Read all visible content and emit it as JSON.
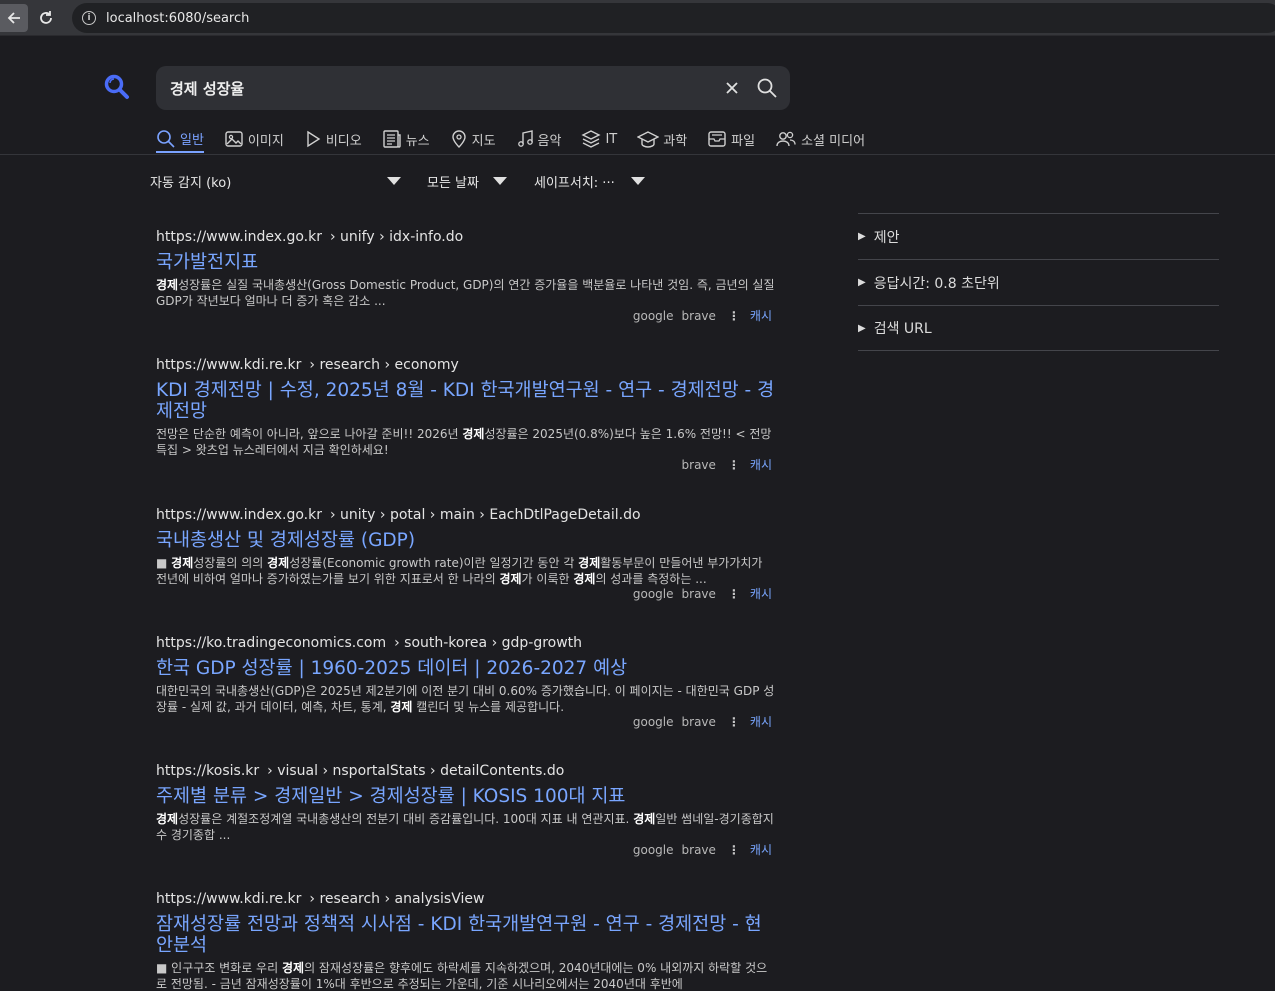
{
  "browser": {
    "url": "localhost:6080/search"
  },
  "search": {
    "query": "경제 성장율"
  },
  "tabs": [
    {
      "label": "일반",
      "icon": "search-icon",
      "active": true
    },
    {
      "label": "이미지",
      "icon": "image-icon"
    },
    {
      "label": "비디오",
      "icon": "play-icon"
    },
    {
      "label": "뉴스",
      "icon": "newspaper-icon"
    },
    {
      "label": "지도",
      "icon": "map-pin-icon"
    },
    {
      "label": "음악",
      "icon": "music-icon"
    },
    {
      "label": "IT",
      "icon": "layers-icon"
    },
    {
      "label": "과학",
      "icon": "graduation-cap-icon"
    },
    {
      "label": "파일",
      "icon": "inbox-icon"
    },
    {
      "label": "소셜 미디어",
      "icon": "users-icon"
    }
  ],
  "filters": {
    "language": "자동 감지 (ko)",
    "time": "모든 날짜",
    "safesearch": "세이프서치: ···"
  },
  "results": [
    {
      "domain": "https://www.index.go.kr",
      "path": "› unify › idx-info.do",
      "title": "국가발전지표",
      "snippet_html": "<b>경제</b>성장률은 실질 국내총생산(Gross Domestic Product, GDP)의 연간 증가율을 백분율로 나타낸 것임. 즉, 금년의 실질 GDP가 작년보다 얼마나 더 증가 혹은 감소 ...",
      "engines": [
        "google",
        "brave"
      ],
      "cache": "캐시"
    },
    {
      "domain": "https://www.kdi.re.kr",
      "path": "› research › economy",
      "title": "KDI 경제전망 | 수정, 2025년 8월 - KDI 한국개발연구원 - 연구 - 경제전망 - 경제전망",
      "snippet_html": "전망은 단순한 예측이 아니라, 앞으로 나아갈 준비!! 2026년 <b>경제</b>성장률은 2025년(0.8%)보다 높은 1.6% 전망!! < 전망특집 > 왓츠업 뉴스레터에서 지금 확인하세요!",
      "engines": [
        "brave"
      ],
      "cache": "캐시"
    },
    {
      "domain": "https://www.index.go.kr",
      "path": "› unity › potal › main › EachDtlPageDetail.do",
      "title": "국내총생산 및 경제성장률 (GDP)",
      "snippet_html": "■ <b>경제</b>성장률의 의의 <b>경제</b>성장률(Economic growth rate)이란 일정기간 동안 각 <b>경제</b>활동부문이 만들어낸 부가가치가 전년에 비하여 얼마나 증가하였는가를 보기 위한 지표로서 한 나라의 <b>경제</b>가 이룩한 <b>경제</b>의 성과를 측정하는 ...",
      "engines": [
        "google",
        "brave"
      ],
      "cache": "캐시"
    },
    {
      "domain": "https://ko.tradingeconomics.com",
      "path": "› south-korea › gdp-growth",
      "title": "한국 GDP 성장률 | 1960-2025 데이터 | 2026-2027 예상",
      "snippet_html": "대한민국의 국내총생산(GDP)은 2025년 제2분기에 이전 분기 대비 0.60% 증가했습니다. 이 페이지는 - 대한민국 GDP 성장률 - 실제 값, 과거 데이터, 예측, 차트, 통계, <b>경제</b> 캘린더 및 뉴스를 제공합니다.",
      "engines": [
        "google",
        "brave"
      ],
      "cache": "캐시"
    },
    {
      "domain": "https://kosis.kr",
      "path": "› visual › nsportalStats › detailContents.do",
      "title": "주제별 분류 > 경제일반 > 경제성장률 | KOSIS 100대 지표",
      "snippet_html": "<b>경제</b>성장률은 계절조정계열 국내총생산의 전분기 대비 증감률입니다. 100대 지표 내 연관지표. <b>경제</b>일반 썸네일-경기종합지수 경기종합 ...",
      "engines": [
        "google",
        "brave"
      ],
      "cache": "캐시"
    },
    {
      "domain": "https://www.kdi.re.kr",
      "path": "› research › analysisView",
      "title": "잠재성장률 전망과 정책적 시사점 - KDI 한국개발연구원 - 연구 - 경제전망 - 현안분석",
      "snippet_html": "■ 인구구조 변화로 우리 <b>경제</b>의 잠재성장률은 향후에도 하락세를 지속하겠으며, 2040년대에는 0% 내외까지 하락할 것으로 전망됨. - 금년 잠재성장률이 1%대 후반으로 추정되는 가운데, 기준 시나리오에서는 2040년대 후반에",
      "engines": [],
      "cache": ""
    }
  ],
  "sidebar": [
    {
      "label": "제안"
    },
    {
      "label": "응답시간: 0.8 초단위"
    },
    {
      "label": "검색 URL"
    }
  ],
  "colors": {
    "background": "#1c1c20",
    "link": "#79a6ff",
    "accent": "#7aa2ff",
    "logo": "#4a6cf7"
  }
}
